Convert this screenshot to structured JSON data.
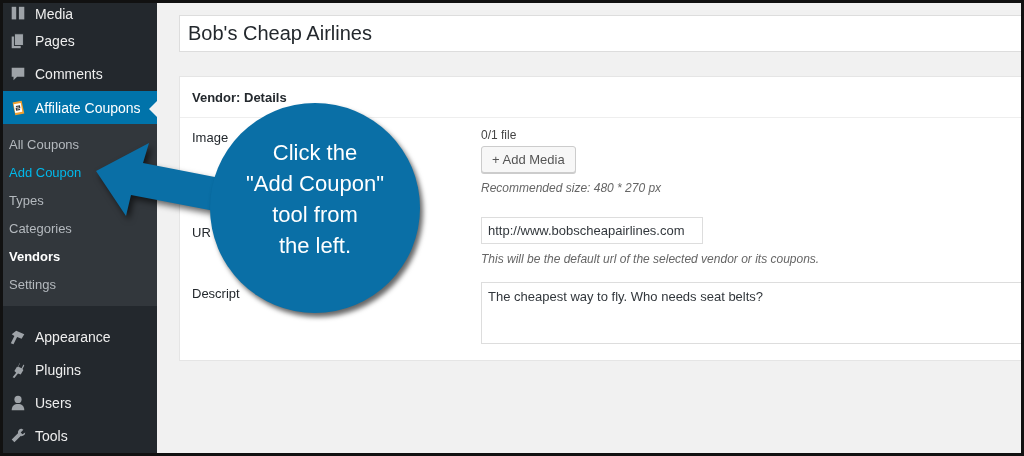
{
  "sidebar": {
    "items": [
      {
        "label": "Media",
        "selected": false
      },
      {
        "label": "Pages",
        "selected": false
      },
      {
        "label": "Comments",
        "selected": false
      },
      {
        "label": "Affiliate Coupons",
        "selected": true,
        "children": [
          {
            "label": "All Coupons",
            "selected": false,
            "hover": false
          },
          {
            "label": "Add Coupon",
            "selected": false,
            "hover": true
          },
          {
            "label": "Types",
            "selected": false,
            "hover": false
          },
          {
            "label": "Categories",
            "selected": false,
            "hover": false
          },
          {
            "label": "Vendors",
            "selected": true,
            "hover": false
          },
          {
            "label": "Settings",
            "selected": false,
            "hover": false
          }
        ]
      },
      {
        "label": "Appearance",
        "selected": false
      },
      {
        "label": "Plugins",
        "selected": false
      },
      {
        "label": "Users",
        "selected": false
      },
      {
        "label": "Tools",
        "selected": false
      }
    ]
  },
  "title_field": {
    "value": "Bob's Cheap Airlines"
  },
  "panel": {
    "title": "Vendor: Details",
    "image": {
      "label": "Image",
      "count": "0/1 file",
      "button": "+ Add Media",
      "hint": "Recommended size: 480 * 270 px"
    },
    "url": {
      "label": "UR",
      "value": "http://www.bobscheapairlines.com",
      "hint": "This will be the default url of the selected vendor or its coupons."
    },
    "description": {
      "label": "Descript",
      "value": "The cheapest way to fly. Who needs seat belts?"
    }
  },
  "callout": {
    "text": "Click the\n\"Add Coupon\"\ntool from\nthe left."
  }
}
